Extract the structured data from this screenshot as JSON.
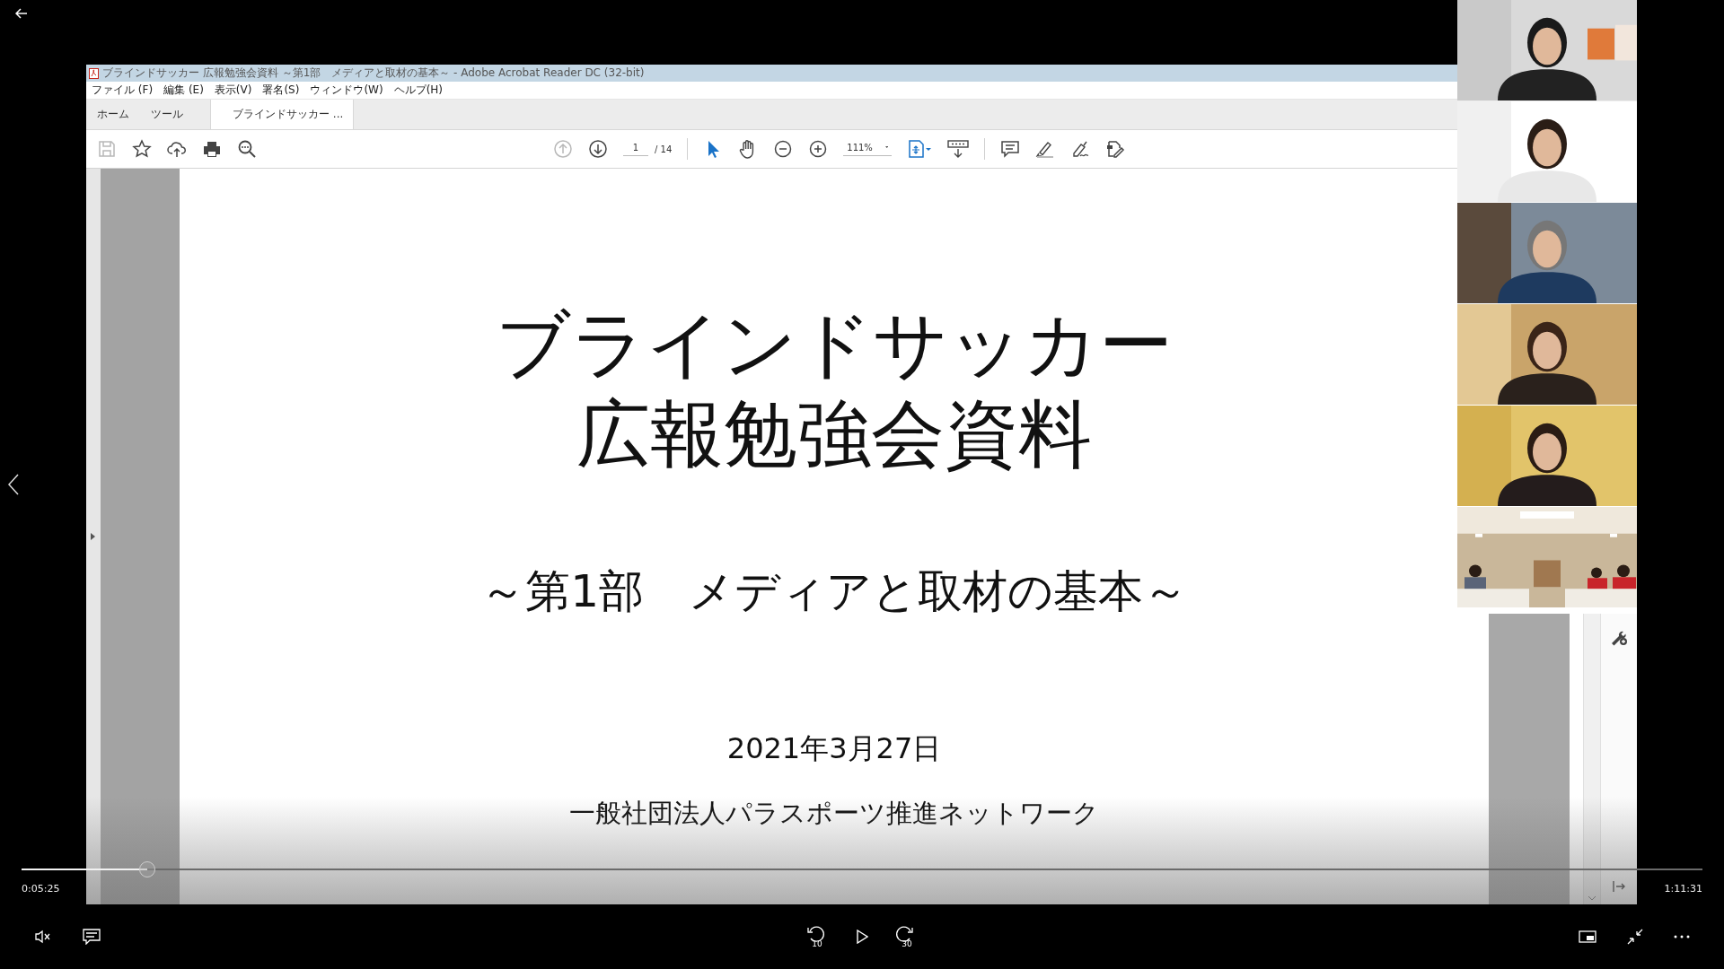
{
  "window": {
    "title": "ブラインドサッカー 広報勉強会資料 ～第1部　メディアと取材の基本～ - Adobe Acrobat Reader DC (32-bit)"
  },
  "menu": [
    "ファイル (F)",
    "編集 (E)",
    "表示(V)",
    "署名(S)",
    "ウィンドウ(W)",
    "ヘルプ(H)"
  ],
  "tabs": [
    {
      "label": "ホーム",
      "selected": false
    },
    {
      "label": "ツール",
      "selected": false
    },
    {
      "label": "ブラインドサッカー ...",
      "selected": true
    }
  ],
  "toolbar_left": [
    {
      "kind": "save",
      "disabled": true
    },
    {
      "kind": "star",
      "disabled": false
    },
    {
      "kind": "upload",
      "disabled": false
    },
    {
      "kind": "print",
      "disabled": false
    },
    {
      "kind": "find",
      "disabled": false
    }
  ],
  "page_nav": {
    "up_disabled": true,
    "page": "1",
    "total": "/ 14"
  },
  "tools": [
    {
      "kind": "select",
      "selected": true
    },
    {
      "kind": "hand",
      "selected": false
    },
    {
      "kind": "zoom_out",
      "selected": false
    },
    {
      "kind": "zoom_in",
      "selected": false
    }
  ],
  "zoom": "111%",
  "document": {
    "title_lines": [
      "ブラインドサッカー",
      "広報勉強会資料"
    ],
    "subtitle": "～第1部　メディアと取材の基本～",
    "date": "2021年3月27日",
    "organization": "一般社団法人パラスポーツ推進ネットワーク"
  },
  "player": {
    "elapsed": "0:05:25",
    "duration": "1:11:31",
    "progress": {
      "level": 0.075
    },
    "muted": true,
    "playing": false,
    "rewind": "10",
    "forward": "30"
  }
}
